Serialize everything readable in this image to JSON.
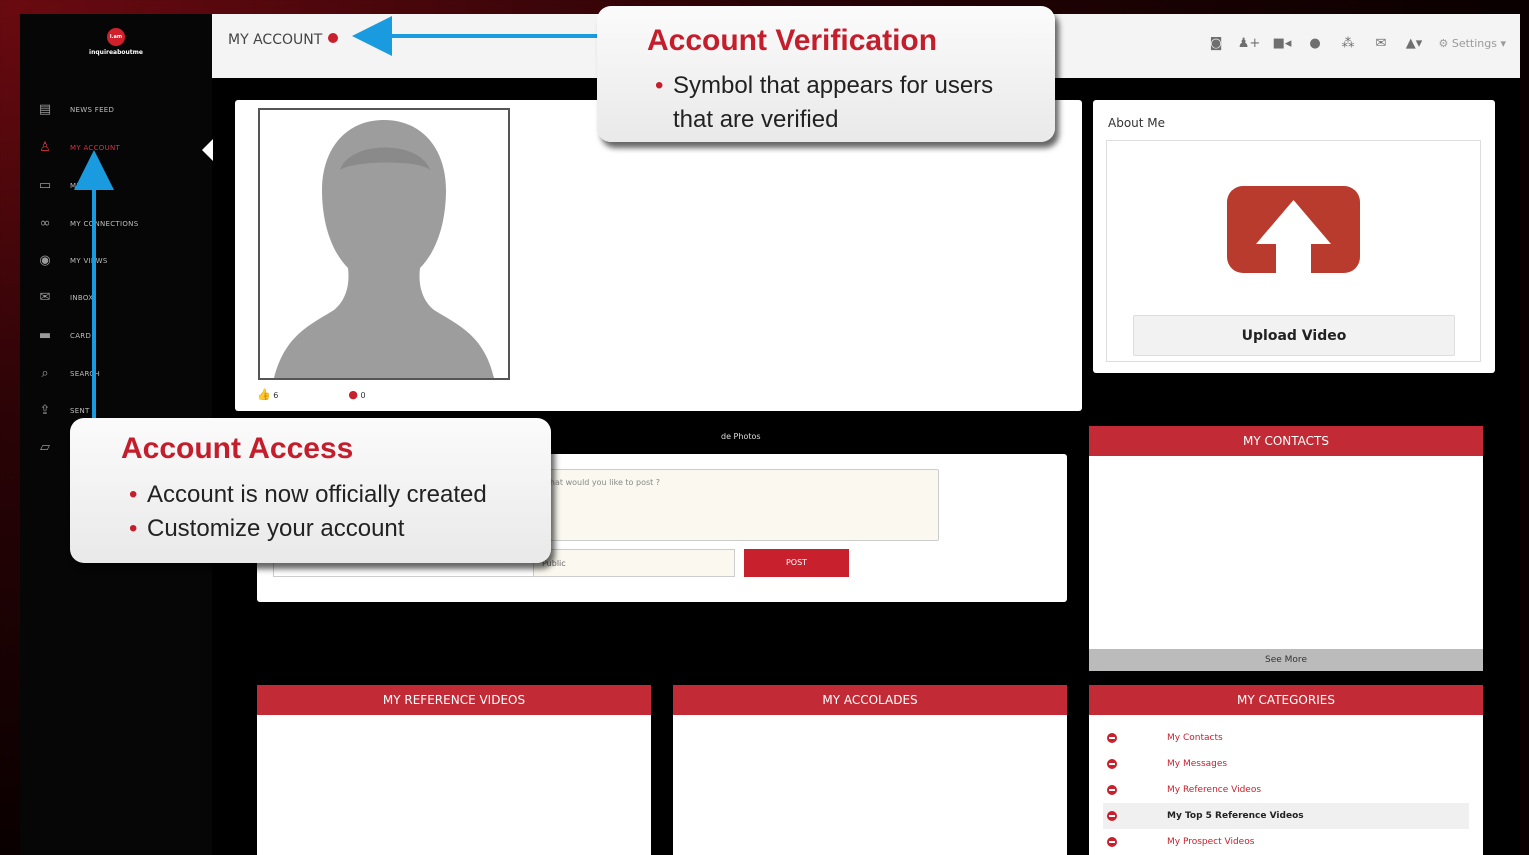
{
  "brand": {
    "logo_badge": "i.am",
    "logo_text": "inquireaboutme"
  },
  "sidebar": {
    "items": [
      {
        "label": "NEWS FEED",
        "icon": "newspaper-icon",
        "active": false
      },
      {
        "label": "MY ACCOUNT",
        "icon": "user-icon",
        "active": true
      },
      {
        "label": "ME",
        "icon": "monitor-icon",
        "active": false
      },
      {
        "label": "MY CONNECTIONS",
        "icon": "link-icon",
        "active": false
      },
      {
        "label": "MY VIEWS",
        "icon": "eye-icon",
        "active": false
      },
      {
        "label": "INBOX",
        "icon": "envelope-icon",
        "active": false
      },
      {
        "label": "CARD",
        "icon": "card-icon",
        "active": false
      },
      {
        "label": "SEARCH",
        "icon": "search-icon",
        "active": false
      },
      {
        "label": "SENT",
        "icon": "share-icon",
        "active": false
      },
      {
        "label": "",
        "icon": "chat-icon",
        "active": false
      }
    ]
  },
  "header": {
    "title": "MY ACCOUNT",
    "settings_label": "⚙ Settings ▾",
    "icons": [
      "camera-icon",
      "add-user-icon",
      "video-icon",
      "chat-icon",
      "group-icon",
      "mail-icon",
      "bell-icon"
    ]
  },
  "profile": {
    "likes": "6",
    "comments": "0"
  },
  "about": {
    "title": "About Me",
    "upload_label": "Upload Video"
  },
  "post": {
    "tabs": [
      "",
      "",
      "",
      "",
      "de Photos"
    ],
    "placeholder": "What would you like to post ?",
    "visibility": "Public",
    "post_label": "POST"
  },
  "contacts": {
    "title": "MY CONTACTS",
    "see_more": "See More"
  },
  "reference_videos": {
    "title": "MY REFERENCE VIDEOS"
  },
  "accolades": {
    "title": "MY ACCOLADES"
  },
  "categories": {
    "title": "MY CATEGORIES",
    "items": [
      {
        "label": "My Contacts",
        "highlight": false
      },
      {
        "label": "My Messages",
        "highlight": false
      },
      {
        "label": "My Reference Videos",
        "highlight": false
      },
      {
        "label": "My Top 5 Reference Videos",
        "highlight": true
      },
      {
        "label": "My Prospect Videos",
        "highlight": false
      }
    ]
  },
  "callouts": {
    "verification": {
      "title": "Account Verification",
      "bullets": [
        "Symbol that appears for users that are verified"
      ]
    },
    "access": {
      "title": "Account Access",
      "bullets": [
        "Account is now officially created",
        "Customize your account"
      ]
    }
  },
  "colors": {
    "brand_red": "#c8202c",
    "callout_red": "#c41e2c",
    "arrow_blue": "#1a9be0"
  }
}
